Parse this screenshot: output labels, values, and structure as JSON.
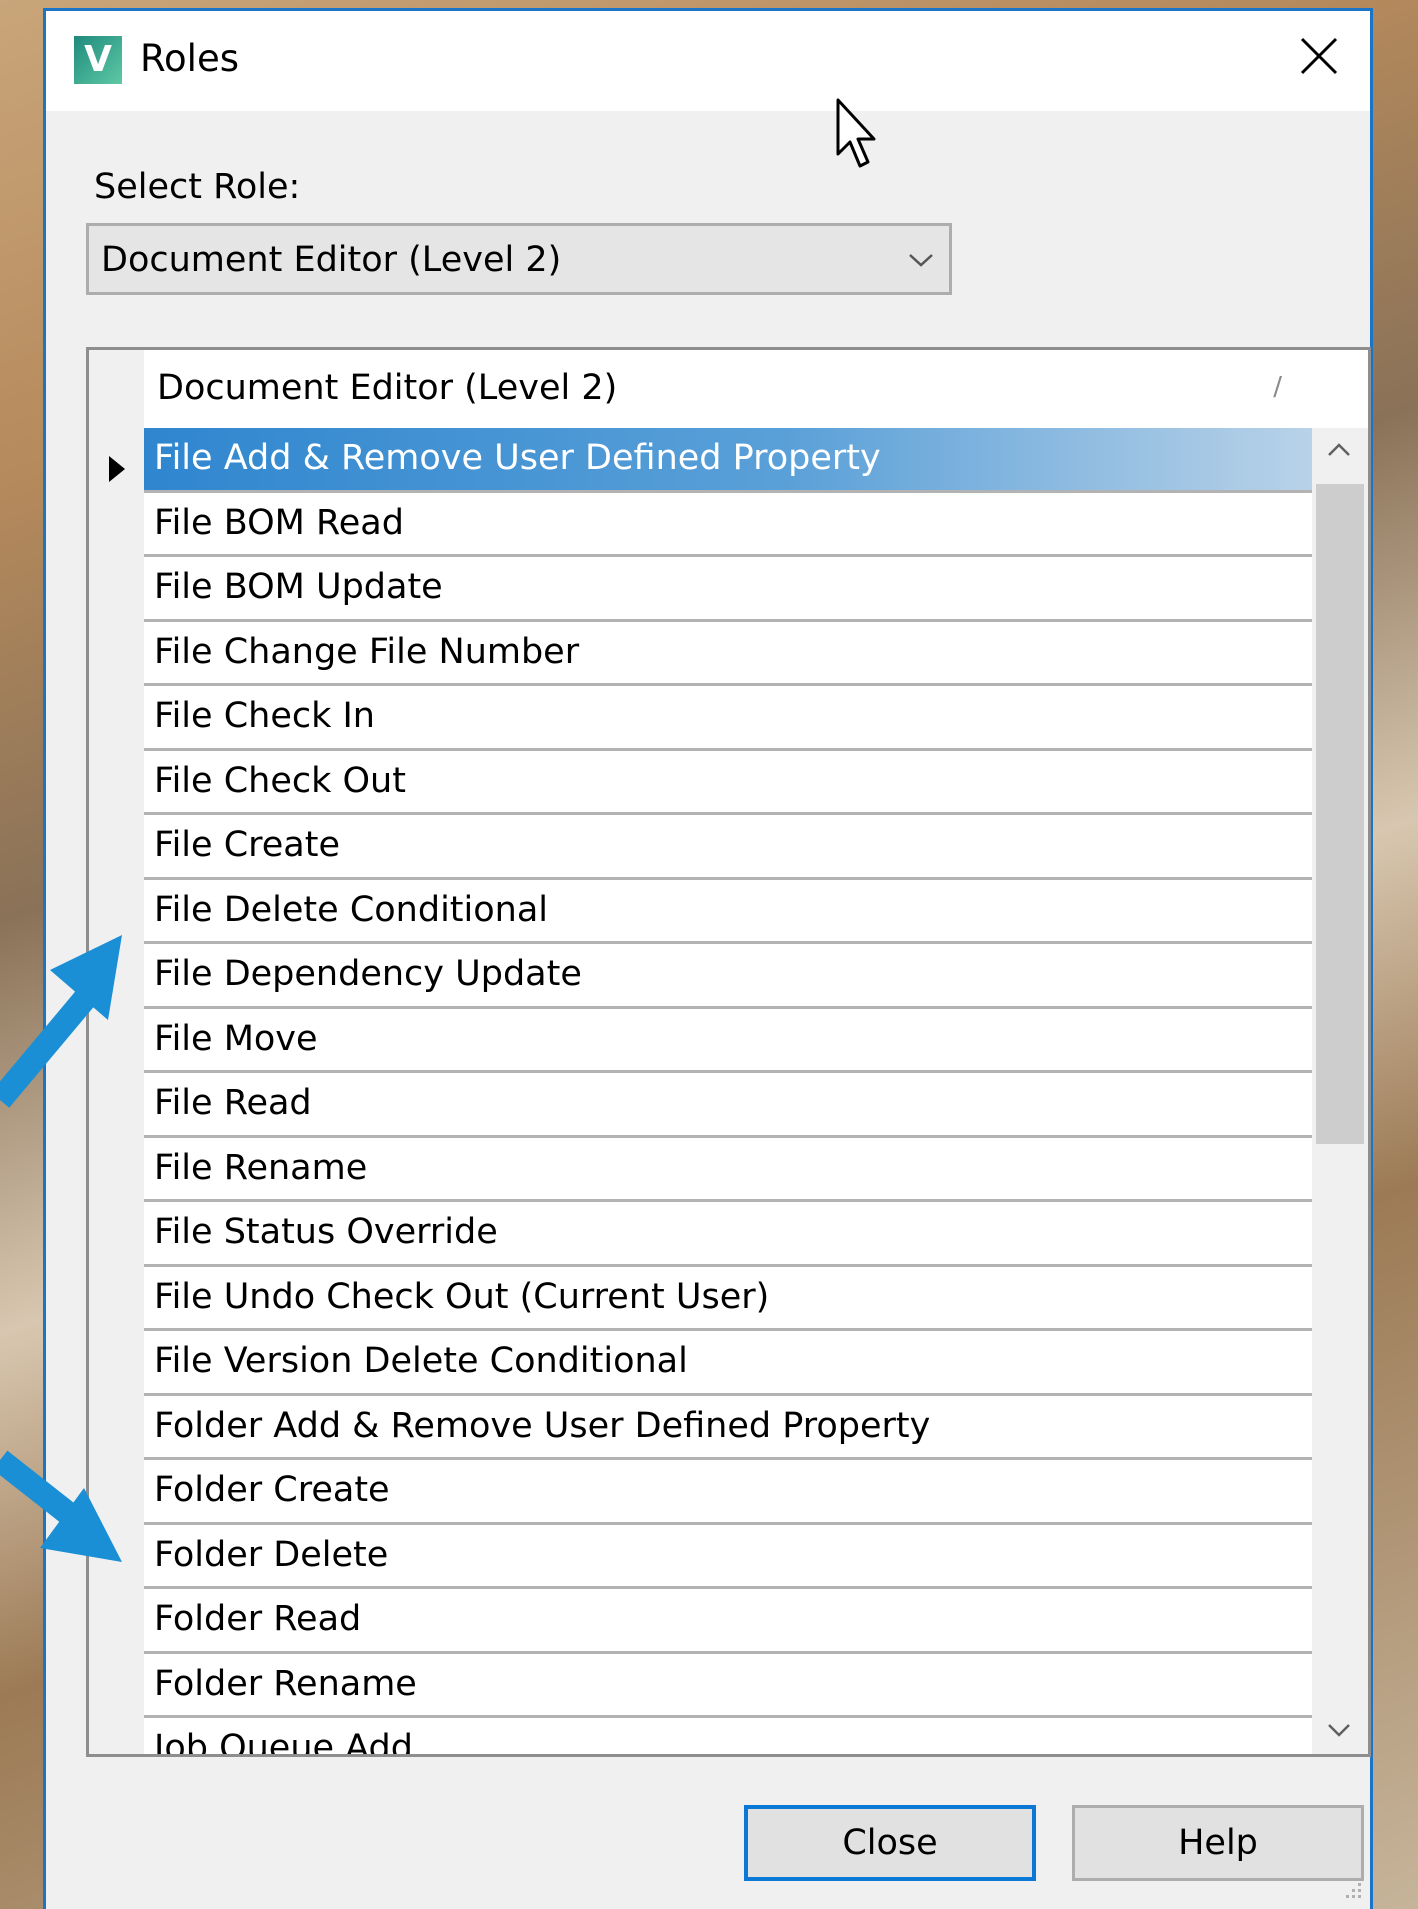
{
  "window": {
    "title": "Roles",
    "icon_letter": "V",
    "close_icon": "close-icon"
  },
  "role_selector": {
    "label": "Select Role:",
    "selected": "Document Editor (Level 2)"
  },
  "grid": {
    "column_header": "Document Editor (Level 2)",
    "sort_indicator": "/",
    "selected_index": 0,
    "rows": [
      "File Add & Remove User Defined Property",
      "File BOM Read",
      "File BOM Update",
      "File Change File Number",
      "File Check In",
      "File Check Out",
      "File Create",
      "File Delete Conditional",
      "File Dependency Update",
      "File Move",
      "File Read",
      "File Rename",
      "File Status Override",
      "File Undo Check Out (Current User)",
      "File Version Delete Conditional",
      "Folder Add & Remove User Defined Property",
      "Folder Create",
      "Folder Delete",
      "Folder Read",
      "Folder Rename",
      "Job Queue Add"
    ]
  },
  "buttons": {
    "close": "Close",
    "help": "Help"
  },
  "colors": {
    "accent": "#1a74c8",
    "annotation_arrow": "#1a8fd6"
  }
}
